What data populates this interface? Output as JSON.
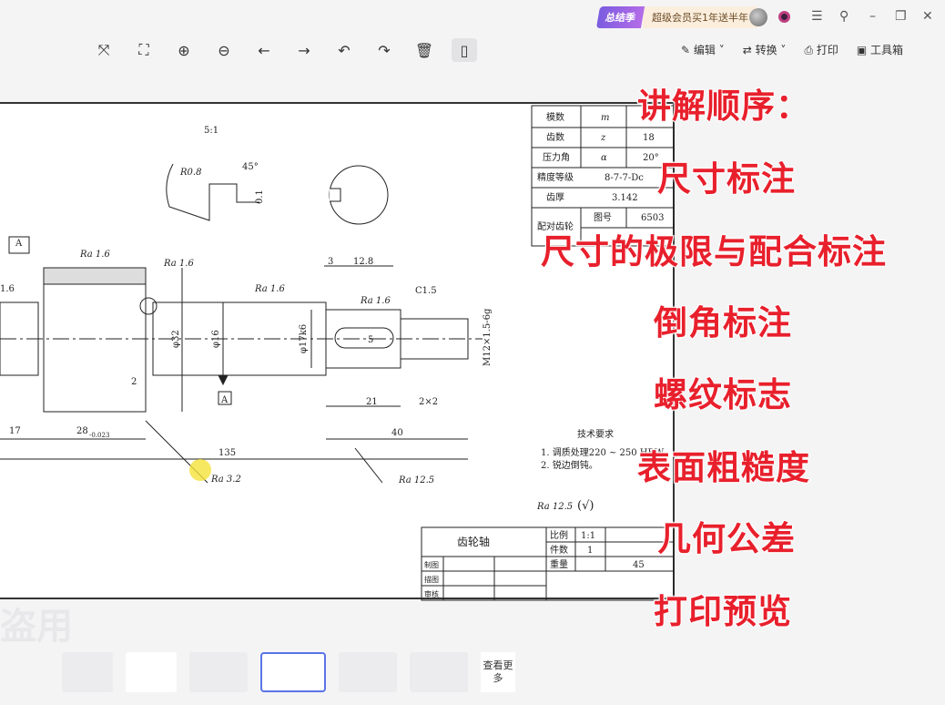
{
  "header": {
    "promo_tag": "总结季",
    "promo_text": "超级会员买1年送半年",
    "window": {
      "menu": "☰",
      "pin": "⚲",
      "minimize": "–",
      "restore": "❐",
      "close": "✕"
    }
  },
  "toolbar": {
    "tools": [
      {
        "name": "fit-page-icon",
        "glyph": "⤧"
      },
      {
        "name": "fullscreen-icon",
        "glyph": "⛶"
      },
      {
        "name": "zoom-in-icon",
        "glyph": "⊕"
      },
      {
        "name": "zoom-out-icon",
        "glyph": "⊖"
      },
      {
        "name": "previous-icon",
        "glyph": "←"
      },
      {
        "name": "next-icon",
        "glyph": "→"
      },
      {
        "name": "rotate-left-icon",
        "glyph": "↶"
      },
      {
        "name": "rotate-right-icon",
        "glyph": "↷"
      },
      {
        "name": "delete-icon",
        "glyph": "🗑"
      },
      {
        "name": "mouse-icon",
        "glyph": "▯"
      }
    ],
    "edit": "编辑",
    "convert": "转换",
    "print": "打印",
    "toolbox": "工具箱"
  },
  "gear_table": {
    "rows": [
      [
        "模数",
        "m",
        ""
      ],
      [
        "齿数",
        "z",
        "18"
      ],
      [
        "压力角",
        "α",
        "20°"
      ],
      [
        "精度等级",
        "8-7-7-Dc",
        ""
      ],
      [
        "齿厚",
        "3.142",
        ""
      ],
      [
        "配对齿轮",
        "图号",
        "6503"
      ]
    ]
  },
  "drawing": {
    "scale_note": "5:1",
    "r08": "R0.8",
    "angle": "45°",
    "d01": "0.1",
    "ra16": "Ra 1.6",
    "ra32": "Ra 3.2",
    "ra125": "Ra 12.5",
    "datum": "A",
    "d32": "φ32",
    "d16": "φ16",
    "d17": "φ17k6",
    "thread": "M12×1.5-6g",
    "c15": "C1.5",
    "dim3": "3",
    "dim128": "12.8",
    "dim5": "5",
    "dim21": "21",
    "dim2x2": "2×2",
    "dim40": "40",
    "dim135": "135",
    "dim17": "17",
    "dim28": "28",
    "dim28tol": "-0.023",
    "dim2": "2",
    "dim16": "1.6",
    "tech_title": "技术要求",
    "tech_items": [
      "1. 调质处理220 ~ 250 HBW。",
      "2. 锐边倒钝。"
    ],
    "general_ra": "Ra 12.5",
    "general_check": "(√)"
  },
  "title_block": {
    "part_name": "齿轮轴",
    "scale_label": "比例",
    "scale": "1:1",
    "qty_label": "件数",
    "qty": "1",
    "weight_label": "重量",
    "material": "45",
    "drawn": "制图",
    "traced": "描图",
    "checked": "审核"
  },
  "overlay": {
    "lines": [
      "讲解顺序：",
      "尺寸标注",
      "尺寸的极限与配合标注",
      "倒角标注",
      "螺纹标志",
      "表面粗糙度",
      "几何公差",
      "打印预览"
    ]
  },
  "watermark": "盗用",
  "thumbnails": {
    "more": "查看更多",
    "count": 6,
    "selected_index": 3
  }
}
